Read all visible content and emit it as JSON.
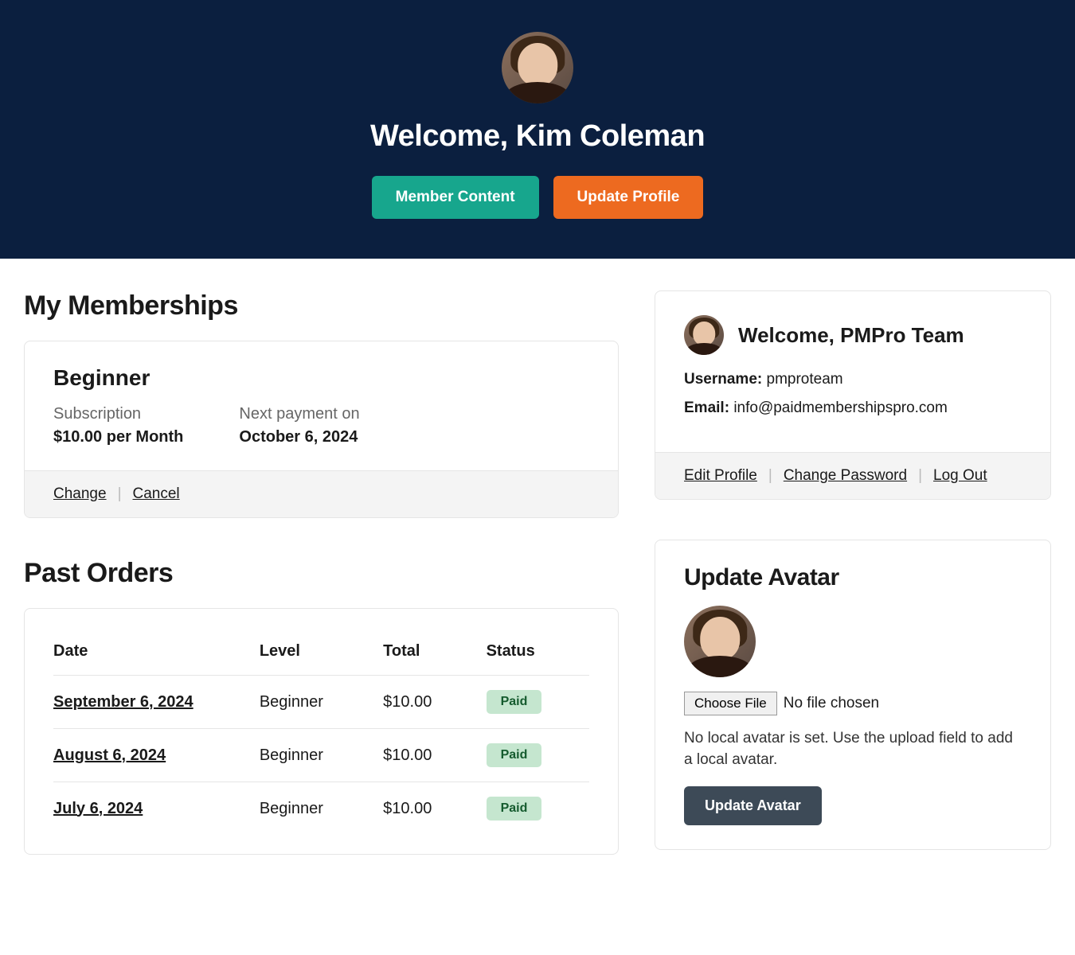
{
  "banner": {
    "welcome": "Welcome, Kim Coleman",
    "member_content_btn": "Member Content",
    "update_profile_btn": "Update Profile"
  },
  "memberships": {
    "heading": "My Memberships",
    "level_name": "Beginner",
    "subscription_label": "Subscription",
    "subscription_value": "$10.00 per Month",
    "next_payment_label": "Next payment on",
    "next_payment_value": "October 6, 2024",
    "change_link": "Change",
    "cancel_link": "Cancel"
  },
  "orders": {
    "heading": "Past Orders",
    "columns": {
      "date": "Date",
      "level": "Level",
      "total": "Total",
      "status": "Status"
    },
    "rows": [
      {
        "date": "September 6, 2024",
        "level": "Beginner",
        "total": "$10.00",
        "status": "Paid"
      },
      {
        "date": "August 6, 2024",
        "level": "Beginner",
        "total": "$10.00",
        "status": "Paid"
      },
      {
        "date": "July 6, 2024",
        "level": "Beginner",
        "total": "$10.00",
        "status": "Paid"
      }
    ]
  },
  "profile": {
    "welcome": "Welcome, PMPro Team",
    "username_label": "Username:",
    "username_value": "pmproteam",
    "email_label": "Email:",
    "email_value": "info@paidmembershipspro.com",
    "edit_link": "Edit Profile",
    "password_link": "Change Password",
    "logout_link": "Log Out"
  },
  "avatar": {
    "heading": "Update Avatar",
    "choose_file_btn": "Choose File",
    "no_file_text": "No file chosen",
    "note": "No local avatar is set. Use the upload field to add a local avatar.",
    "update_btn": "Update Avatar"
  }
}
